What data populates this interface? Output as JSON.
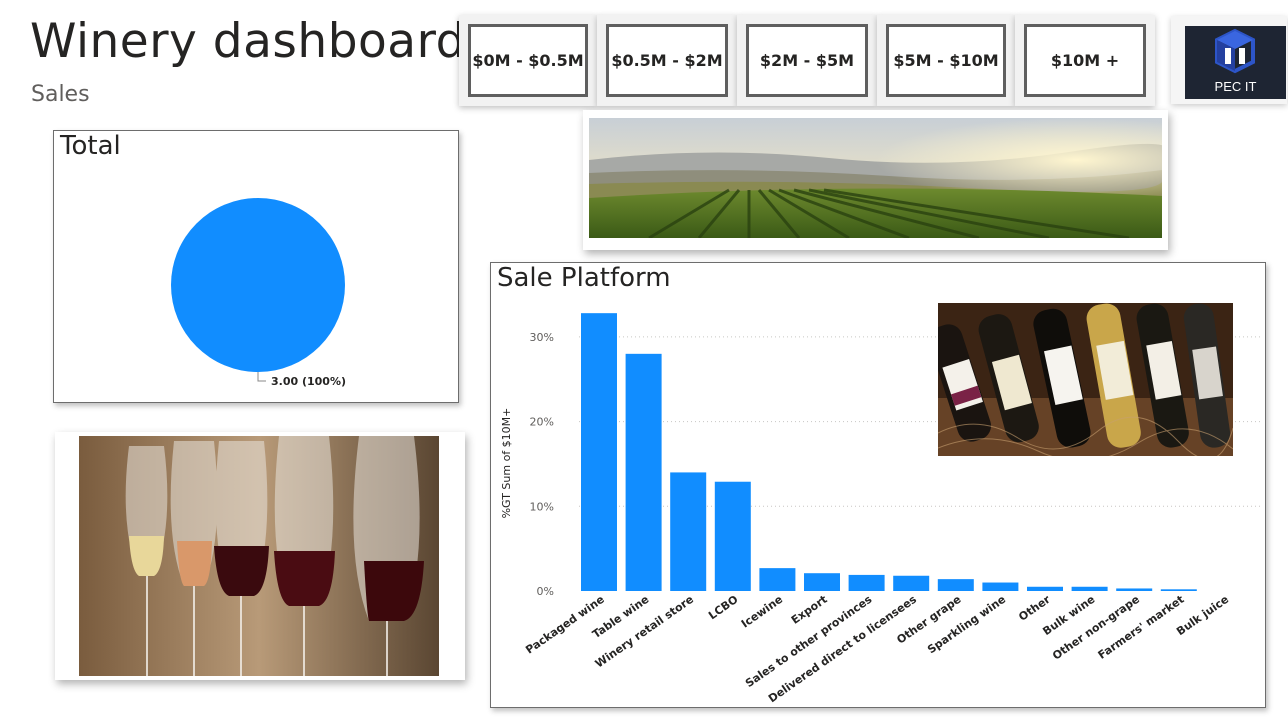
{
  "header": {
    "title": "Winery dashboard",
    "subtitle": "Sales"
  },
  "slicers": [
    {
      "label": "$0M - $0.5M"
    },
    {
      "label": "$0.5M - $2M"
    },
    {
      "label": "$2M - $5M"
    },
    {
      "label": "$5M - $10M"
    },
    {
      "label": "$10M +"
    }
  ],
  "logo": {
    "text": "PEC IT"
  },
  "colors": {
    "accent": "#118dff",
    "border": "#5f5f5f",
    "text": "#252423"
  },
  "chart_data": [
    {
      "type": "pie",
      "title": "Total",
      "values": [
        3.0
      ],
      "data_label": "3.00 (100%)",
      "color": "#118dff"
    },
    {
      "type": "bar",
      "title": "Sale Platform",
      "ylabel": "%GT Sum of $10M+",
      "xlabel": "",
      "ylim": [
        0,
        34
      ],
      "yticks": [
        0,
        10,
        20,
        30
      ],
      "ytick_labels": [
        "0%",
        "10%",
        "20%",
        "30%"
      ],
      "grid": true,
      "categories": [
        "Packaged wine",
        "Table wine",
        "Winery retail store",
        "LCBO",
        "Icewine",
        "Export",
        "Sales to other provinces",
        "Delivered direct to licensees",
        "Other grape",
        "Sparkling wine",
        "Other",
        "Bulk wine",
        "Other non-grape",
        "Farmers' market",
        "Bulk juice"
      ],
      "values": [
        32.8,
        28.0,
        14.0,
        12.9,
        2.7,
        2.1,
        1.9,
        1.8,
        1.4,
        1.0,
        0.5,
        0.5,
        0.3,
        0.2,
        0.0
      ],
      "color": "#118dff"
    }
  ]
}
